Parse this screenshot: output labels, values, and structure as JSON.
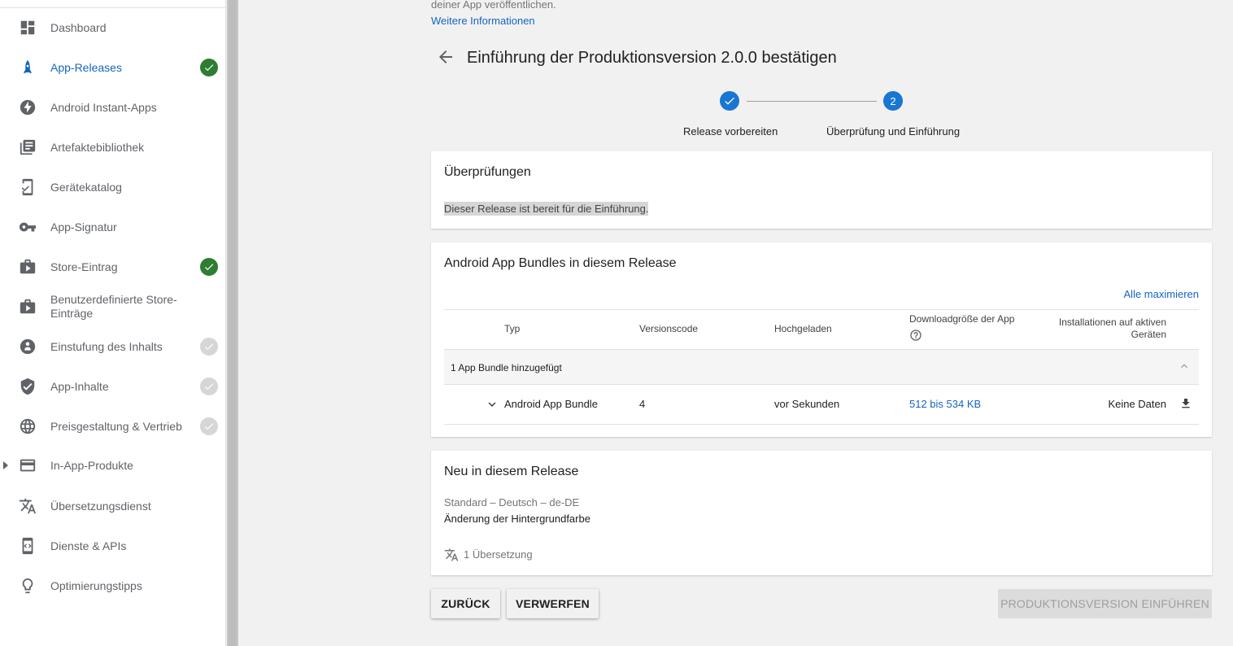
{
  "sidebar": {
    "items": [
      {
        "label": "Dashboard",
        "icon": "dashboard-icon",
        "status": "none"
      },
      {
        "label": "App-Releases",
        "icon": "rocket-icon",
        "status": "done",
        "active": true
      },
      {
        "label": "Android Instant-Apps",
        "icon": "bolt-icon",
        "status": "none"
      },
      {
        "label": "Artefaktebibliothek",
        "icon": "library-icon",
        "status": "none"
      },
      {
        "label": "Gerätekatalog",
        "icon": "device-check-icon",
        "status": "none"
      },
      {
        "label": "App-Signatur",
        "icon": "key-icon",
        "status": "none"
      },
      {
        "label": "Store-Eintrag",
        "icon": "store-icon",
        "status": "done"
      },
      {
        "label": "Benutzerdefinierte Store-Einträge",
        "icon": "store-icon",
        "status": "none"
      },
      {
        "label": "Einstufung des Inhalts",
        "icon": "rating-icon",
        "status": "pending"
      },
      {
        "label": "App-Inhalte",
        "icon": "shield-icon",
        "status": "pending"
      },
      {
        "label": "Preisgestaltung & Vertrieb",
        "icon": "globe-icon",
        "status": "pending"
      },
      {
        "label": "In-App-Produkte",
        "icon": "card-icon",
        "status": "none",
        "expandable": true
      },
      {
        "label": "Übersetzungsdienst",
        "icon": "translate-icon",
        "status": "none"
      },
      {
        "label": "Dienste & APIs",
        "icon": "api-icon",
        "status": "none"
      },
      {
        "label": "Optimierungstipps",
        "icon": "lightbulb-icon",
        "status": "none"
      }
    ]
  },
  "header": {
    "top_text": "deiner App veröffentlichen.",
    "more_info_link": "Weitere Informationen",
    "title": "Einführung der Produktionsversion 2.0.0 bestätigen"
  },
  "stepper": {
    "step1_label": "Release vorbereiten",
    "step2_number": "2",
    "step2_label": "Überprüfung und Einführung"
  },
  "checks_card": {
    "title": "Überprüfungen",
    "message": "Dieser Release ist bereit für die Einführung."
  },
  "bundles_card": {
    "title": "Android App Bundles in diesem Release",
    "maximize_link": "Alle maximieren",
    "columns": {
      "type": "Typ",
      "version_code": "Versionscode",
      "uploaded": "Hochgeladen",
      "download_size": "Downloadgröße der App",
      "installs": "Installationen auf aktiven Geräten"
    },
    "group_label": "1 App Bundle hinzugefügt",
    "row": {
      "type": "Android App Bundle",
      "version_code": "4",
      "uploaded": "vor Sekunden",
      "download_size": "512 bis 534 KB",
      "installs": "Keine Daten"
    }
  },
  "notes_card": {
    "title": "Neu in diesem Release",
    "language": "Standard – Deutsch – de-DE",
    "text": "Änderung der Hintergrundfarbe",
    "translations": "1 Übersetzung"
  },
  "actions": {
    "back_label": "ZURÜCK",
    "discard_label": "VERWERFEN",
    "rollout_label": "PRODUKTIONSVERSION EINFÜHREN"
  },
  "colors": {
    "accent": "#1565c0",
    "success": "#2e7d32",
    "step": "#1976d2"
  }
}
